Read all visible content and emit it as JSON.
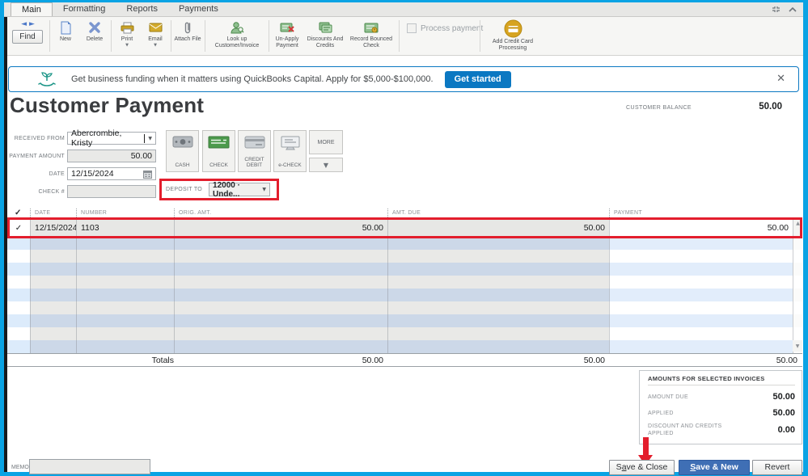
{
  "colors": {
    "frame_blue": "#0aa3e4",
    "banner_blue": "#0b78c2",
    "accent_red": "#e31e2d",
    "save_new_blue": "#3f6fb5"
  },
  "tabs": [
    {
      "label": "Main"
    },
    {
      "label": "Formatting"
    },
    {
      "label": "Reports"
    },
    {
      "label": "Payments"
    }
  ],
  "toolbar": {
    "find_label": "Find",
    "buttons": [
      {
        "label": "New"
      },
      {
        "label": "Delete"
      },
      {
        "label": "Print"
      },
      {
        "label": "Email"
      },
      {
        "label": "Attach File"
      },
      {
        "label": "Look up Customer/Invoice"
      },
      {
        "label": "Un-Apply Payment"
      },
      {
        "label": "Discounts And Credits"
      },
      {
        "label": "Record Bounced Check"
      }
    ],
    "process_payment_label": "Process payment",
    "add_credit_card_label": "Add Credit Card Processing"
  },
  "banner": {
    "message": "Get business funding when it matters using QuickBooks Capital. Apply for $5,000-$100,000.",
    "cta_label": "Get started",
    "close_glyph": "✕"
  },
  "header": {
    "title": "Customer Payment",
    "customer_balance_label": "CUSTOMER BALANCE",
    "customer_balance_value": "50.00"
  },
  "form": {
    "received_from": {
      "label": "RECEIVED FROM",
      "value": "Abercrombie, Kristy"
    },
    "payment_amount": {
      "label": "PAYMENT AMOUNT",
      "value": "50.00"
    },
    "date": {
      "label": "DATE",
      "value": "12/15/2024"
    },
    "check_number": {
      "label": "CHECK #",
      "value": ""
    },
    "deposit_to": {
      "label": "DEPOSIT TO",
      "value": "12000 · Unde..."
    }
  },
  "payment_methods": [
    {
      "label": "CASH"
    },
    {
      "label": "CHECK",
      "selected": true
    },
    {
      "label": "CREDIT DEBIT"
    },
    {
      "label": "e-CHECK"
    }
  ],
  "more_button": {
    "label": "MORE"
  },
  "table": {
    "check_header": "✓",
    "columns": [
      "DATE",
      "NUMBER",
      "ORIG. AMT.",
      "AMT. DUE",
      "PAYMENT"
    ],
    "rows": [
      {
        "check": "✓",
        "date": "12/15/2024",
        "number": "1103",
        "orig_amt": "50.00",
        "amt_due": "50.00",
        "payment": "50.00"
      }
    ],
    "empty_row_count": 9,
    "totals": {
      "label": "Totals",
      "orig_amt": "50.00",
      "amt_due": "50.00",
      "payment": "50.00"
    }
  },
  "summary": {
    "title": "AMOUNTS FOR SELECTED INVOICES",
    "rows": [
      {
        "label": "AMOUNT DUE",
        "value": "50.00"
      },
      {
        "label": "APPLIED",
        "value": "50.00"
      },
      {
        "label": "DISCOUNT AND CREDITS APPLIED",
        "value": "0.00"
      }
    ]
  },
  "footer": {
    "memo_label": "MEMO",
    "save_close": {
      "pre": "S",
      "underline": "a",
      "post": "ve & Close"
    },
    "save_new": {
      "pre": "",
      "underline": "S",
      "post": "ave & New"
    },
    "revert_label": "Revert"
  }
}
